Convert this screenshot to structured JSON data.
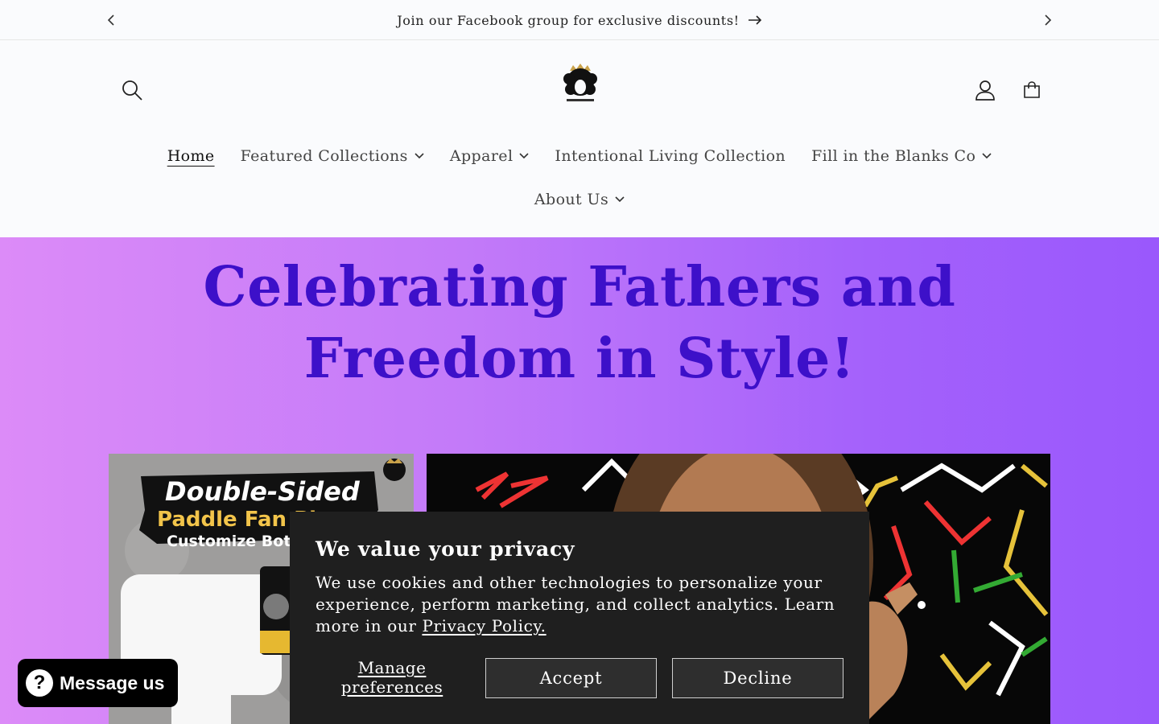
{
  "announcement": {
    "text": "Join our Facebook group for exclusive discounts!"
  },
  "header": {
    "logo_alt": "Fros & Bros",
    "nav": [
      {
        "label": "Home",
        "active": true,
        "dropdown": false
      },
      {
        "label": "Featured Collections",
        "dropdown": true
      },
      {
        "label": "Apparel",
        "dropdown": true
      },
      {
        "label": "Intentional Living Collection",
        "dropdown": false
      },
      {
        "label": "Fill in the Blanks Co",
        "dropdown": true
      },
      {
        "label": "About Us",
        "dropdown": true
      }
    ]
  },
  "hero": {
    "title_line1": "Celebrating Fathers and",
    "title_line2": "Freedom in Style!",
    "left_card": {
      "line1": "Double-Sided",
      "line2": "Paddle Fan Pl...",
      "line3": "Customize Both..."
    }
  },
  "cookie": {
    "heading": "We value your privacy",
    "body": "We use cookies and other technologies to personalize your experience, perform marketing, and collect analytics. Learn more in our ",
    "policy_link": "Privacy Policy.",
    "manage_line1": "Manage",
    "manage_line2": "preferences",
    "accept": "Accept",
    "decline": "Decline"
  },
  "messenger": {
    "label": "Message us"
  },
  "colors": {
    "hero_title": "#3d10c9",
    "hero_gradient_start": "#dc8bf8",
    "hero_gradient_end": "#9a58fc",
    "cookie_bg": "#1f1f1f"
  }
}
